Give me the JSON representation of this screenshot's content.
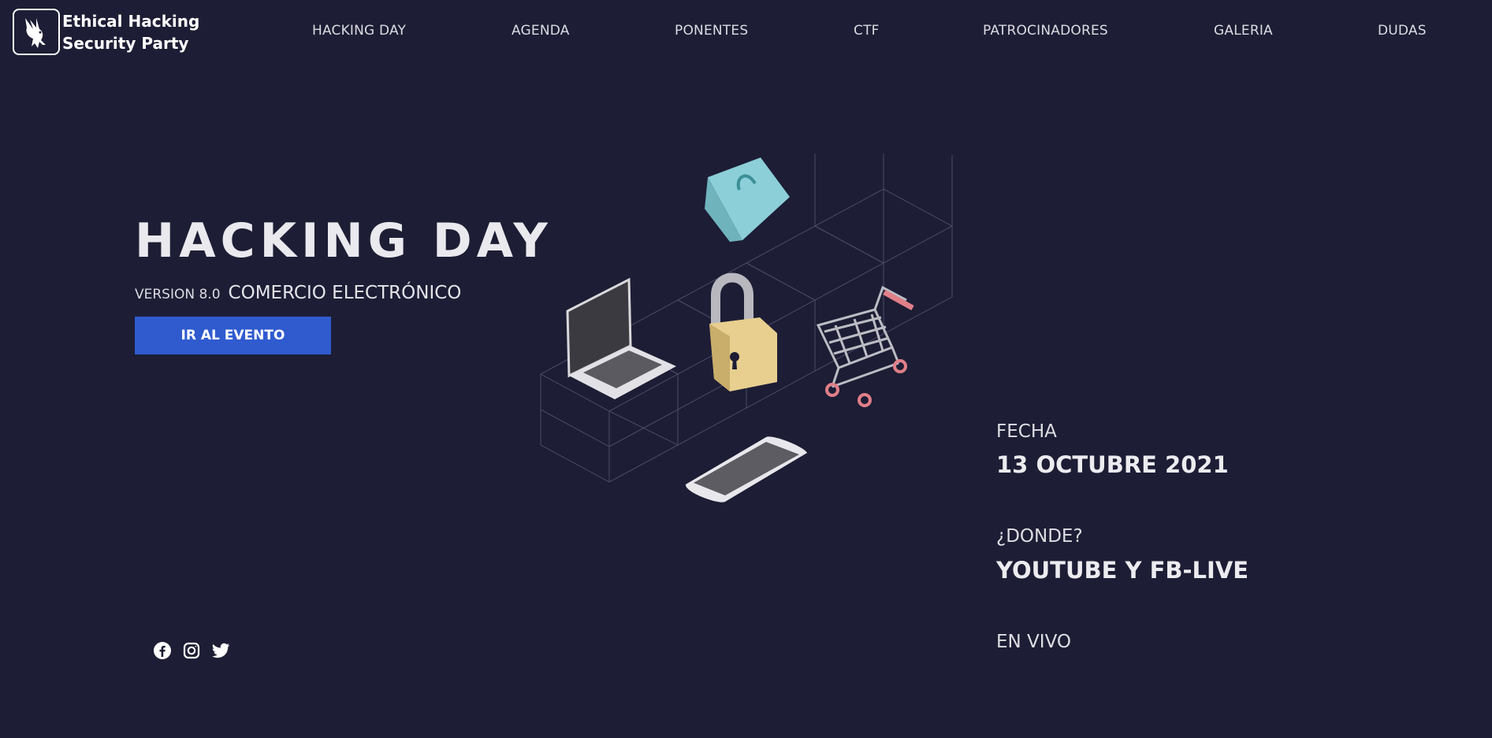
{
  "brand": {
    "line1": "Ethical Hacking",
    "line2": "Security Party",
    "logo_icon": "eagle-icon"
  },
  "nav": {
    "items": [
      {
        "label": "HACKING DAY"
      },
      {
        "label": "AGENDA"
      },
      {
        "label": "PONENTES"
      },
      {
        "label": "CTF"
      },
      {
        "label": "PATROCINADORES"
      },
      {
        "label": "GALERIA"
      },
      {
        "label": "DUDAS"
      }
    ]
  },
  "hero": {
    "title": "HACKING DAY",
    "version": "VERSION 8.0",
    "topic": "COMERCIO ELECTRÓNICO",
    "cta_label": "IR AL EVENTO"
  },
  "info": {
    "date_label": "FECHA",
    "date_value": "13 OCTUBRE 2021",
    "where_label": "¿DONDE?",
    "where_value": "YOUTUBE Y FB-LIVE",
    "live_label": "EN VIVO"
  },
  "social": {
    "icons": [
      "facebook-icon",
      "instagram-icon",
      "twitter-icon"
    ]
  },
  "colors": {
    "background": "#1d1d35",
    "accent": "#2f5bcf",
    "text": "#e6e6ea"
  }
}
